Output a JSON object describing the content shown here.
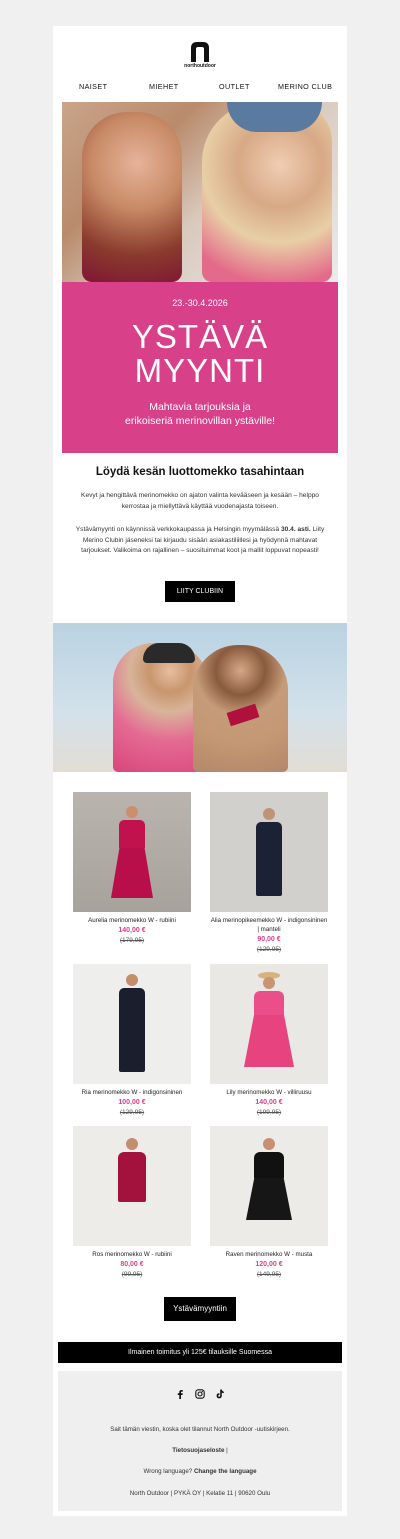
{
  "brand": {
    "logo_text": "northoutdoor"
  },
  "nav": {
    "items": [
      "NAISET",
      "MIEHET",
      "OUTLET",
      "MERINO CLUB"
    ]
  },
  "hero": {
    "date": "23.-30.4.2026",
    "title_line1": "YSTÄVÄ",
    "title_line2": "MYYNTI",
    "subtitle_line1": "Mahtavia tarjouksia ja",
    "subtitle_line2": "erikoiseriä merinovillan ystäville!"
  },
  "intro": {
    "heading": "Löydä kesän luottomekko tasahintaan",
    "p1": "Kevyt ja hengittävä merinomekko on ajaton valinta kevääseen ja kesään – helppo kerrostaa ja miellyttävä käyttää vuodenajasta toiseen.",
    "p2_a": "Ystävämyynti on käynnissä verkkokaupassa ja Helsingin myymälässä ",
    "p2_bold": "30.4. asti.",
    "p2_b": " Liity Merino Clubin jäseneksi tai kirjaudu sisään asiakastiliillesi ja hyödynnä mahtavat tarjoukset. Valikoima on rajallinen – suosituimmat koot ja mallit loppuvat nopeasti!",
    "button": "LIITY CLUBIIN"
  },
  "products": [
    {
      "name": "Aurelia merinomekko W - rubiini",
      "price": "140,00 €",
      "old_price": "(179,95)"
    },
    {
      "name": "Alia merinopikeemekko W - indigonsininen | manteli",
      "price": "90,00 €",
      "old_price": "(129,95)"
    },
    {
      "name": "Ria merinomekko W - indigonsininen",
      "price": "100,00 €",
      "old_price": "(129,95)"
    },
    {
      "name": "Lily merinomekko W - villiruusu",
      "price": "140,00 €",
      "old_price": "(199,95)"
    },
    {
      "name": "Ros merinomekko W - rubiini",
      "price": "80,00 €",
      "old_price": "(99,95)"
    },
    {
      "name": "Raven merinomekko W - musta",
      "price": "120,00 €",
      "old_price": "(149,95)"
    }
  ],
  "cta": {
    "button": "Ystävämyyntiin"
  },
  "shipping": {
    "text": "Ilmainen toimitus yli 125€ tilauksille Suomessa"
  },
  "social": {
    "icons": [
      "facebook-icon",
      "instagram-icon",
      "tiktok-icon"
    ]
  },
  "footer": {
    "reason": "Sait tämän viestin, koska olet tilannut North Outdoor -uutiskirjeen.",
    "privacy": "Tietosuojaseloste",
    "privacy_sep": " |",
    "wrong_lang": "Wrong language? ",
    "change_lang": "Change the language",
    "address": "North Outdoor | PYKÄ OY | Kelatie 11 | 90620 Oulu"
  },
  "colors": {
    "accent": "#d9408a",
    "black": "#000000",
    "footer_bg": "#efefef"
  }
}
